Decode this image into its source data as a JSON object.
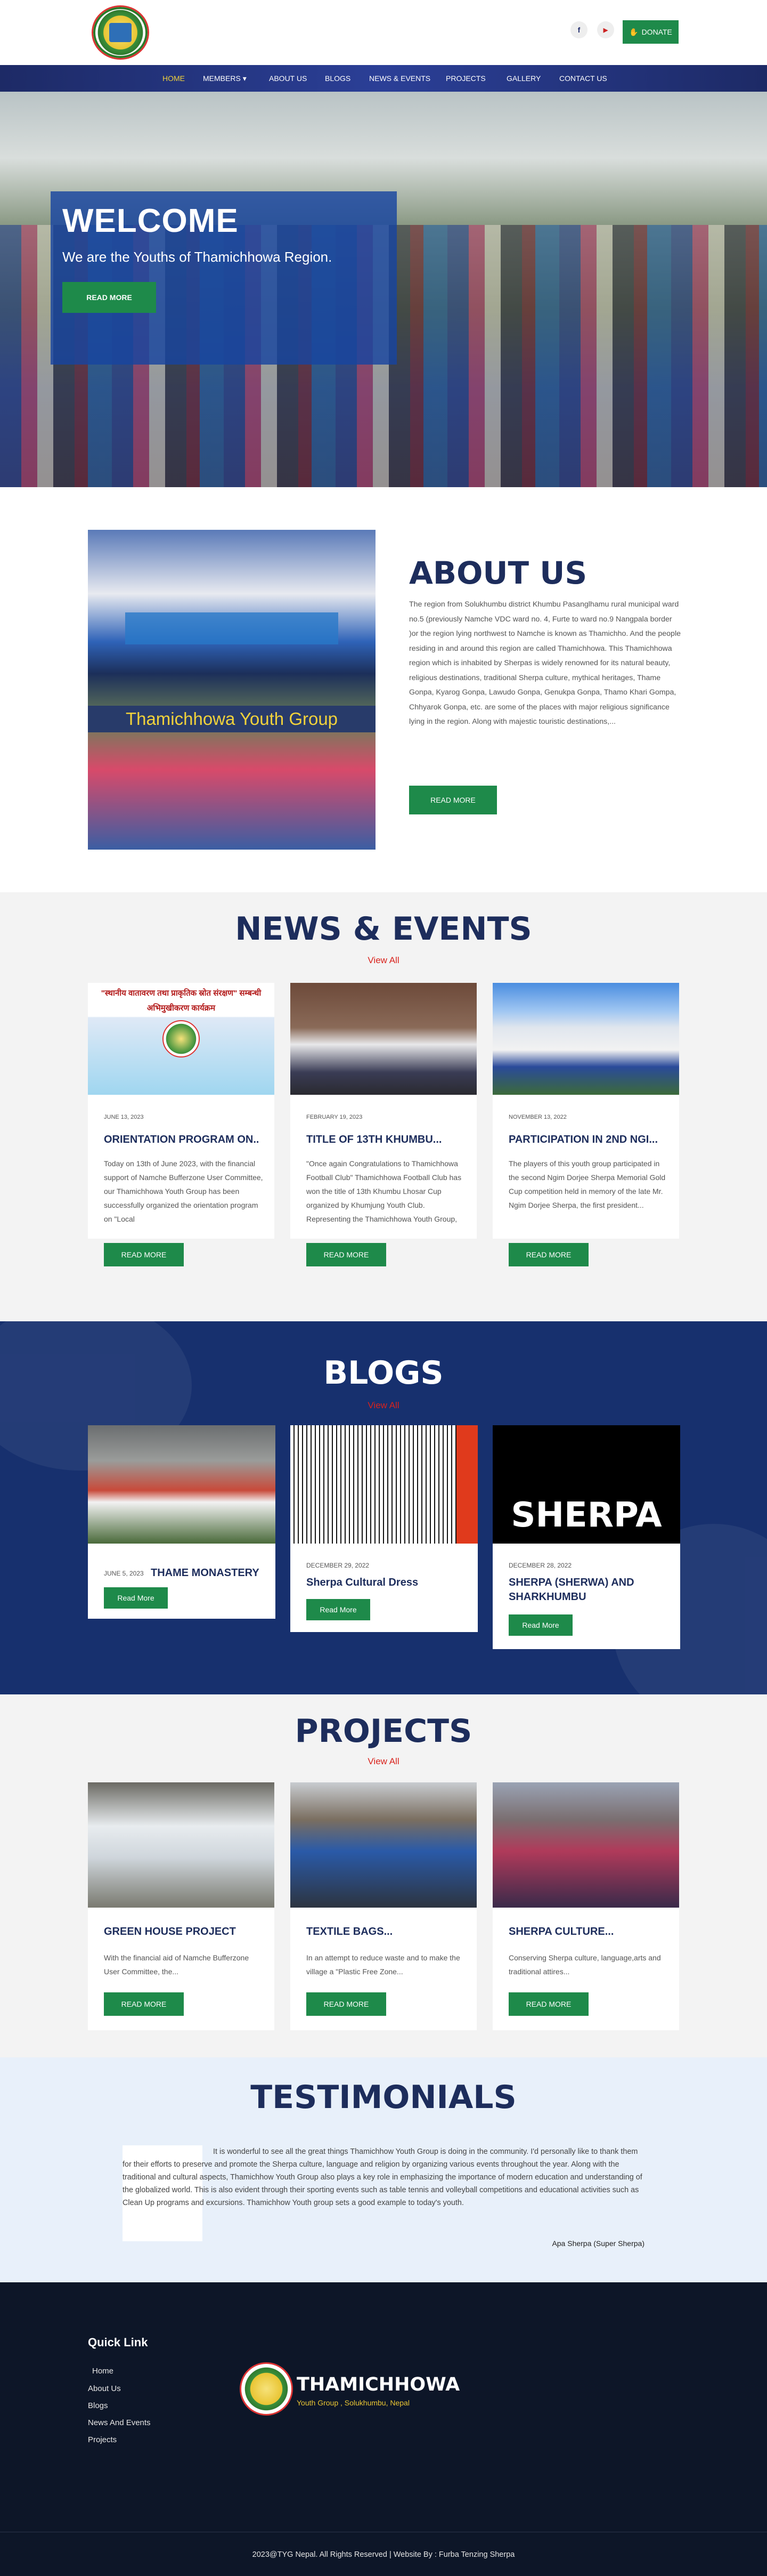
{
  "header": {
    "facebook_glyph": "f",
    "youtube_glyph": "▶",
    "donate_label": "DONATE"
  },
  "nav": {
    "items": [
      "HOME",
      "MEMBERS",
      "ABOUT US",
      "BLOGS",
      "NEWS & EVENTS",
      "PROJECTS",
      "GALLERY",
      "CONTACT US"
    ],
    "members_caret": "▾"
  },
  "hero": {
    "title": "WELCOME",
    "subtitle": "We are the Youths of Thamichhowa Region.",
    "cta": "READ MORE"
  },
  "about": {
    "image_caption": "Thamichhowa Youth Group",
    "title": "ABOUT US",
    "text": "The region from Solukhumbu district Khumbu Pasanglhamu rural municipal ward no.5 (previously Namche VDC ward no. 4, Furte to ward no.9 Nangpala border )or the region lying northwest to Namche is known as Thamichho. And the people residing in and around this region are called Thamichhowa. This Thamichhowa region which is inhabited by Sherpas is widely renowned for its natural beauty, religious destinations, traditional Sherpa culture, mythical heritages, Thame Gonpa, Kyarog Gonpa, Lawudo Gonpa, Genukpa Gonpa, Thamo Khari Gompa, Chhyarok Gonpa, etc. are some of the places with major religious significance lying in the region. Along with majestic touristic destinations,...",
    "cta": "READ MORE"
  },
  "news": {
    "title": "NEWS & EVENTS",
    "view_all": "View All",
    "items": [
      {
        "date": "JUNE 13, 2023",
        "title": "ORIENTATION PROGRAM ON...",
        "excerpt": "Today on 13th of June 2023, with the financial support of Namche Bufferzone User Committee, our Thamichhowa Youth Group has been successfully organized the orientation program on \"Local",
        "cta": "READ MORE",
        "thumb_text": "\"स्थानीय वातावरण तथा प्राकृतिक स्रोत संरक्षण\" सम्बन्धी अभिमुखीकरण कार्यक्रम"
      },
      {
        "date": "FEBRUARY 19, 2023",
        "title": "TITLE OF 13TH KHUMBU...",
        "excerpt": "\"Once again Congratulations to Thamichhowa Football Club\" Thamichhowa Football Club has won the title of 13th Khumbu Lhosar Cup organized by Khumjung Youth Club. Representing the Thamichhowa Youth Group, Thamichhowa...",
        "cta": "READ MORE"
      },
      {
        "date": "NOVEMBER 13, 2022",
        "title": "PARTICIPATION IN 2ND NGI...",
        "excerpt": "The players of this youth group participated in the second Ngim Dorjee Sherpa Memorial Gold Cup competition held in memory of the late Mr. Ngim Dorjee Sherpa, the first president...",
        "cta": "READ MORE"
      }
    ]
  },
  "blogs": {
    "title": "BLOGS",
    "view_all": "View All",
    "items": [
      {
        "date": "JUNE 5, 2023",
        "title": "THAME MONASTERY",
        "cta": "Read More"
      },
      {
        "date": "DECEMBER 29, 2022",
        "title": "Sherpa Cultural Dress",
        "cta": "Read More"
      },
      {
        "date": "DECEMBER 28, 2022",
        "title": "SHERPA (SHERWA) AND SHARKHUMBU",
        "cta": "Read More",
        "thumb_text": "SHERPA"
      }
    ]
  },
  "projects": {
    "title": "PROJECTS",
    "view_all": "View All",
    "items": [
      {
        "title": "GREEN HOUSE PROJECT",
        "excerpt": "With the financial aid of Namche Bufferzone User Committee, the...",
        "cta": "READ MORE"
      },
      {
        "title": "TEXTILE BAGS...",
        "excerpt": "In an attempt to reduce waste and to make the village a \"Plastic Free Zone...",
        "cta": "READ MORE"
      },
      {
        "title": "SHERPA CULTURE...",
        "excerpt": "Conserving Sherpa culture, language,arts and traditional attires...",
        "cta": "READ MORE"
      }
    ]
  },
  "testimonials": {
    "title": "TESTIMONIALS",
    "quote": "It is wonderful to see all the great things Thamichhow Youth Group is doing in the community.  I'd personally like to thank them for their efforts to preserve and promote the Sherpa culture, language and religion by organizing various events throughout the year.  Along with the traditional and cultural aspects, Thamichhow Youth Group also plays a key role in emphasizing the importance of modern education and understanding of the globalized world. This is also evident through their sporting events such as table tennis and volleyball competitions and educational activities such as Clean Up programs and excursions. Thamichhow Youth group sets a good example to today's youth.",
    "author": "Apa Sherpa (Super Sherpa)"
  },
  "footer": {
    "quick_link_title": "Quick Link",
    "links": [
      "Home",
      "About Us",
      "Blogs",
      "News And Events",
      "Projects"
    ],
    "brand": "THAMICHHOWA",
    "tagline": "Youth Group , Solukhumbu, Nepal",
    "copyright": "2023@TYG Nepal. All Rights Reserved | Website By : Furba Tenzing Sherpa"
  },
  "colors": {
    "navy": "#1d2d5c",
    "green_button": "#1e8a4a",
    "accent_red": "#d9221c",
    "nav_active": "#f1d23b",
    "blogs_bg": "#17306e",
    "footer_bg": "#0d1628"
  }
}
